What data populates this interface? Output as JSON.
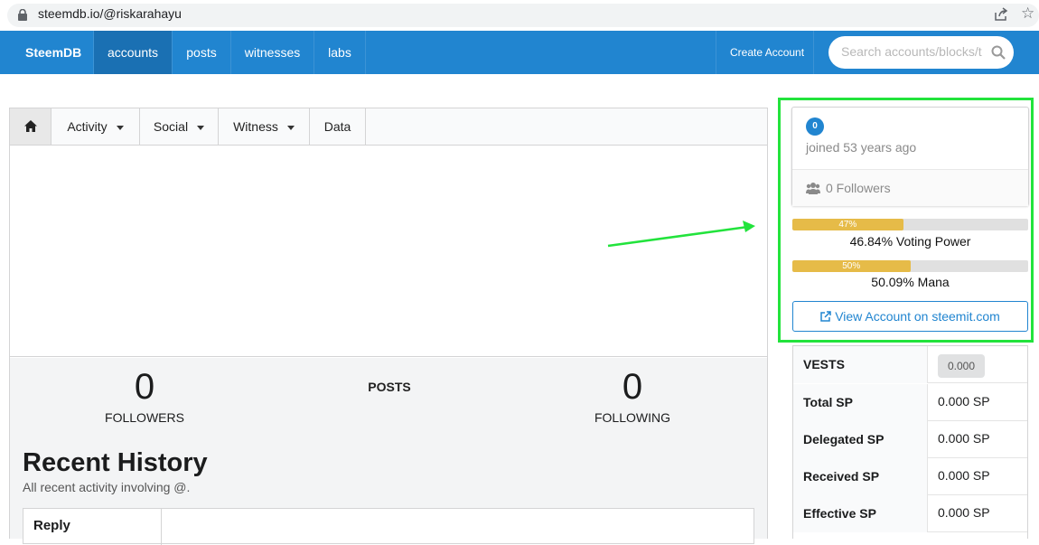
{
  "browser": {
    "url": "steemdb.io/@riskarahayu"
  },
  "navbar": {
    "brand": "SteemDB",
    "items": [
      {
        "label": "accounts",
        "active": true
      },
      {
        "label": "posts",
        "active": false
      },
      {
        "label": "witnesses",
        "active": false
      },
      {
        "label": "labs",
        "active": false
      }
    ],
    "create_account": "Create Account",
    "search_placeholder": "Search accounts/blocks/t"
  },
  "tabs": {
    "activity": "Activity",
    "social": "Social",
    "witness": "Witness",
    "data": "Data"
  },
  "stats": {
    "followers_count": "0",
    "followers_label": "FOLLOWERS",
    "posts_label": "POSTS",
    "following_count": "0",
    "following_label": "FOLLOWING"
  },
  "recent_history": {
    "title": "Recent History",
    "subtitle": "All recent activity involving @.",
    "first_row_type": "Reply"
  },
  "account_card": {
    "level": "0",
    "joined": "joined 53 years ago",
    "followers": "0 Followers"
  },
  "voting_power": {
    "percent": 47,
    "bar_text": "47%",
    "label": "46.84% Voting Power"
  },
  "mana": {
    "percent": 50,
    "bar_text": "50%",
    "label": "50.09% Mana"
  },
  "view_account_button": "View Account on steemit.com",
  "sp_table": [
    {
      "key": "VESTS",
      "value": "0.000",
      "pill": true
    },
    {
      "key": "Total SP",
      "value": "0.000 SP"
    },
    {
      "key": "Delegated SP",
      "value": "0.000 SP"
    },
    {
      "key": "Received SP",
      "value": "0.000 SP"
    },
    {
      "key": "Effective SP",
      "value": "0.000 SP"
    }
  ],
  "colors": {
    "nav_blue": "#2185d0",
    "bar_gold": "#e6bb48",
    "highlight_green": "#22e33c"
  }
}
